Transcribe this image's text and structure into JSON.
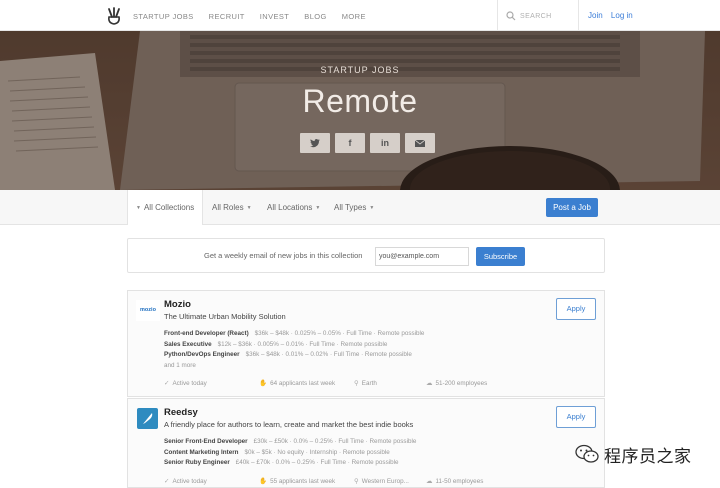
{
  "nav": {
    "links": [
      "STARTUP JOBS",
      "RECRUIT",
      "INVEST",
      "BLOG",
      "MORE"
    ],
    "search_placeholder": "SEARCH",
    "join": "Join",
    "login": "Log in"
  },
  "hero": {
    "subtitle": "STARTUP JOBS",
    "title": "Remote",
    "share": [
      {
        "icon": "twitter-icon",
        "glyph": "🐦"
      },
      {
        "icon": "facebook-icon",
        "glyph": "f"
      },
      {
        "icon": "linkedin-icon",
        "glyph": "in"
      },
      {
        "icon": "email-icon",
        "glyph": "✉"
      }
    ]
  },
  "filters": {
    "collections": "All Collections",
    "roles": "All Roles",
    "locations": "All Locations",
    "types": "All Types",
    "post_job": "Post a Job"
  },
  "subscribe": {
    "text": "Get a weekly email of new jobs in this collection",
    "placeholder": "you@example.com",
    "button": "Subscribe"
  },
  "companies": [
    {
      "name": "Mozio",
      "logo_text": "mozio",
      "tagline": "The Ultimate Urban Mobility Solution",
      "apply": "Apply",
      "jobs": [
        {
          "title": "Front-end Developer (React)",
          "details": "$36k – $48k · 0.025% – 0.05% · Full Time · Remote possible"
        },
        {
          "title": "Sales Executive",
          "details": "$12k – $36k · 0.005% – 0.01% · Full Time · Remote possible"
        },
        {
          "title": "Python/DevOps Engineer",
          "details": "$36k – $48k · 0.01% – 0.02% · Full Time · Remote possible"
        }
      ],
      "more": "and 1 more",
      "activity": "Active today",
      "applicants": "64 applicants last week",
      "location": "Earth",
      "size": "51-200 employees"
    },
    {
      "name": "Reedsy",
      "logo_text": "",
      "tagline": "A friendly place for authors to learn, create and market the best indie books",
      "apply": "Apply",
      "jobs": [
        {
          "title": "Senior Front-End Developer",
          "details": "£30k – £50k · 0.0% – 0.25% · Full Time · Remote possible"
        },
        {
          "title": "Content Marketing Intern",
          "details": "$0k – $5k · No equity · Internship · Remote possible"
        },
        {
          "title": "Senior Ruby Engineer",
          "details": "£40k – £70k · 0.0% – 0.25% · Full Time · Remote possible"
        }
      ],
      "activity": "Active today",
      "applicants": "55 applicants last week",
      "location": "Western Europ...",
      "size": "11-50 employees"
    }
  ],
  "watermark": "程序员之家"
}
